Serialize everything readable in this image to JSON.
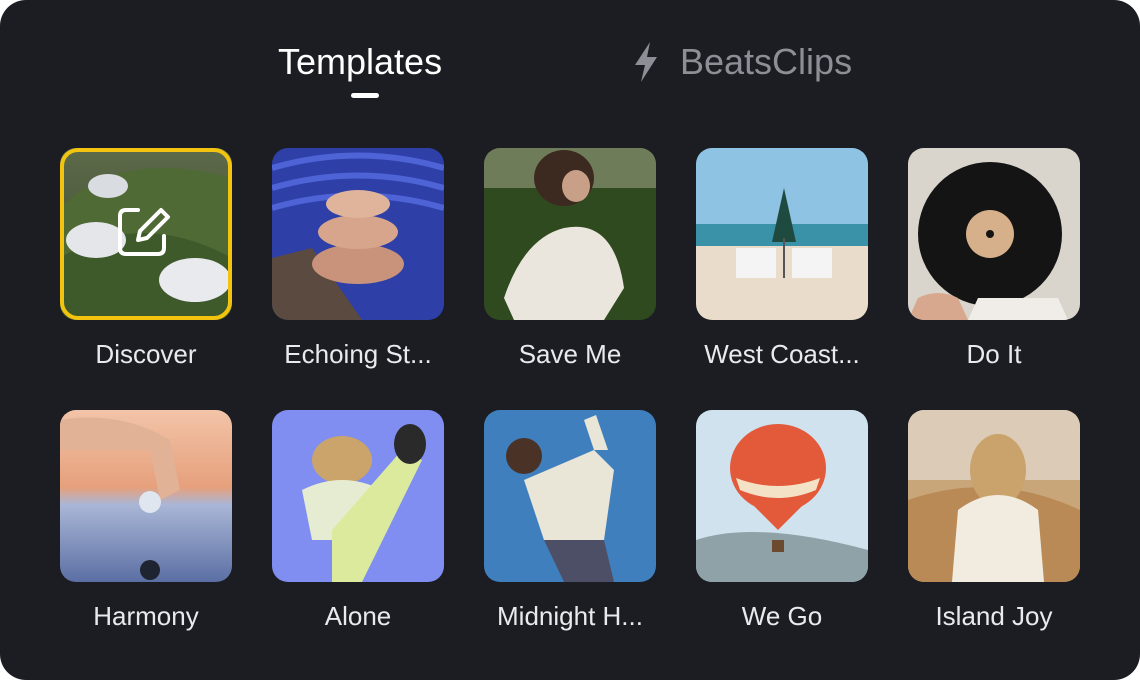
{
  "tabs": {
    "templates": "Templates",
    "beatsclips": "BeatsClips"
  },
  "colors": {
    "background": "#1c1d22",
    "selected_border": "#f2c40f",
    "active_tab": "#ffffff",
    "inactive_tab": "#8d8f96"
  },
  "items": [
    {
      "label": "Discover",
      "icon": "edit-icon",
      "selected": true
    },
    {
      "label": "Echoing St..."
    },
    {
      "label": "Save Me"
    },
    {
      "label": "West Coast..."
    },
    {
      "label": "Do It"
    },
    {
      "label": "Harmony"
    },
    {
      "label": "Alone"
    },
    {
      "label": "Midnight H..."
    },
    {
      "label": "We Go"
    },
    {
      "label": "Island Joy"
    }
  ]
}
